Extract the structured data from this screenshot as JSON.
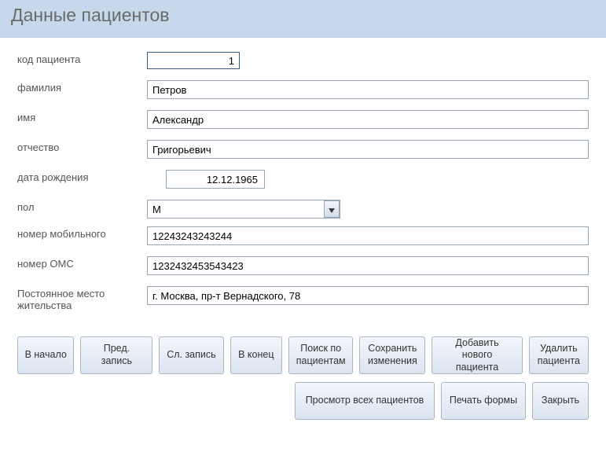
{
  "title": "Данные пациентов",
  "fields": {
    "patient_id": {
      "label": "код пациента",
      "value": "1"
    },
    "surname": {
      "label": "фамилия",
      "value": "Петров"
    },
    "name": {
      "label": "имя",
      "value": "Александр"
    },
    "patronymic": {
      "label": "отчество",
      "value": "Григорьевич"
    },
    "dob": {
      "label": "дата рождения",
      "value": "12.12.1965"
    },
    "sex": {
      "label": "пол",
      "value": "М"
    },
    "mobile": {
      "label": "номер мобильного",
      "value": "12243243243244"
    },
    "oms": {
      "label": "номер ОМС",
      "value": "1232432453543423"
    },
    "address": {
      "label": "Постоянное место жительства",
      "value": "г. Москва, пр-т Вернадского, 78"
    }
  },
  "buttons": {
    "first": "В начало",
    "prev": "Пред. запись",
    "next": "Сл. запись",
    "last": "В конец",
    "search": "Поиск по\nпациентам",
    "save": "Сохранить\nизменения",
    "addnew": "Добавить нового\nпациента",
    "delete": "Удалить\nпациента",
    "viewall": "Просмотр всех пациентов",
    "print": "Печать формы",
    "close": "Закрыть"
  }
}
